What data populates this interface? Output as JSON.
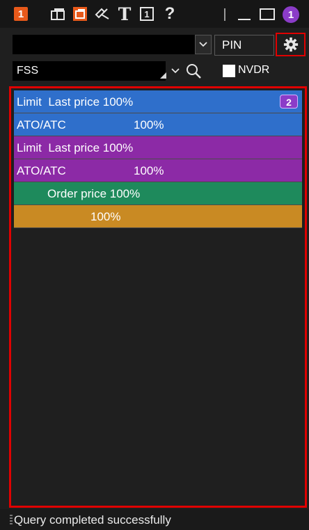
{
  "titlebar": {
    "window_number": "1",
    "notification_count": "1",
    "text_icon": "T",
    "help_icon": "?"
  },
  "toolbar": {
    "symbol_value": "",
    "pin_label": "PIN",
    "account_value": "FSS",
    "nvdr_label": "NVDR",
    "nvdr_checked": false
  },
  "orders": [
    {
      "label": "Limit  Last price 100%",
      "badge": "2",
      "color": "#2f6fcb"
    },
    {
      "label": "ATO/ATC",
      "percent": "100%",
      "color": "#2f6fcb"
    },
    {
      "label": "Limit  Last price 100%",
      "color": "#8c2aa6"
    },
    {
      "label": "ATO/ATC",
      "percent": "100%",
      "color": "#8c2aa6"
    },
    {
      "label": "Order price 100%",
      "color": "#1e8a5c"
    },
    {
      "percent": "100%",
      "color": "#c98a23"
    }
  ],
  "status": {
    "message": "Query completed successfully"
  },
  "colors": {
    "accent_orange": "#e8591a",
    "accent_purple": "#8b3cc8",
    "highlight_red": "#e00000"
  }
}
